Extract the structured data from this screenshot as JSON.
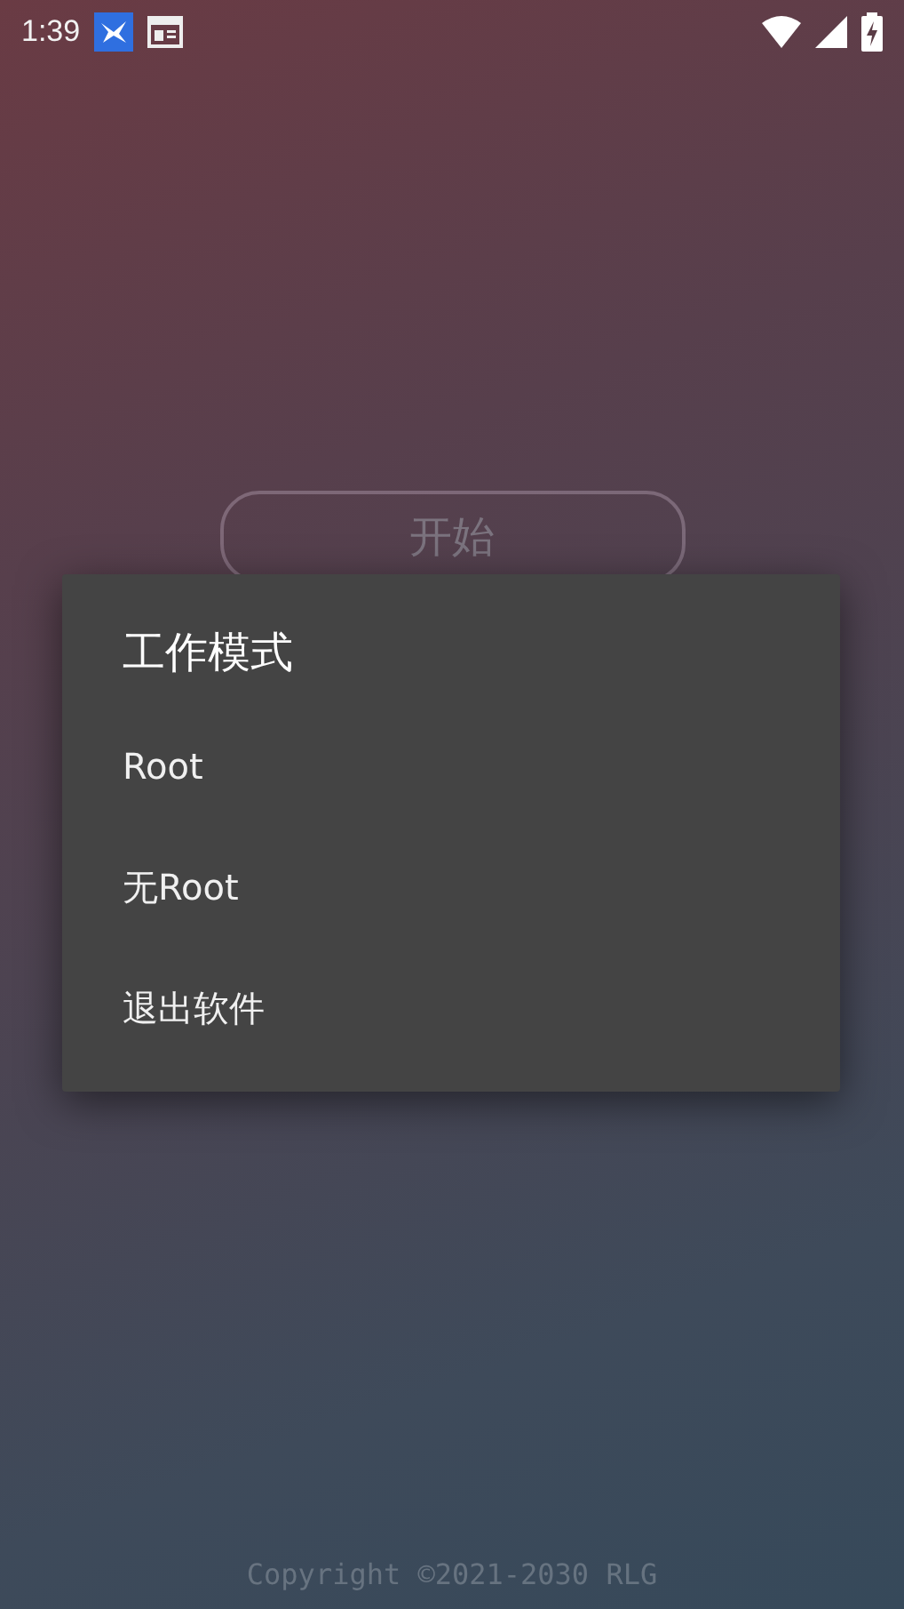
{
  "status_bar": {
    "time": "1:39"
  },
  "start_button": {
    "label": "开始"
  },
  "dialog": {
    "title": "工作模式",
    "items": [
      {
        "label": "Root"
      },
      {
        "label": "无Root"
      },
      {
        "label": "退出软件"
      }
    ]
  },
  "footer": {
    "copyright": "Copyright ©2021-2030 RLG"
  }
}
